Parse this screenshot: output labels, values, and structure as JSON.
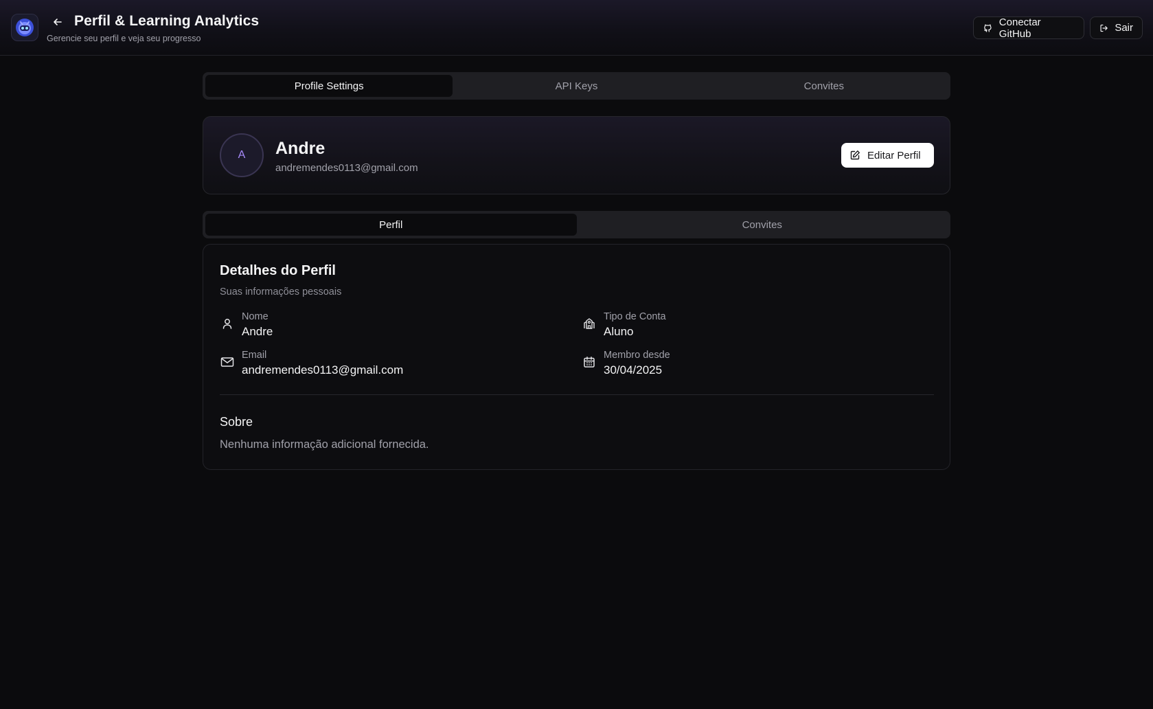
{
  "header": {
    "title": "Perfil & Learning Analytics",
    "subtitle": "Gerencie seu perfil e veja seu progresso",
    "github_button": "Conectar GitHub",
    "logout_button": "Sair"
  },
  "top_tabs": [
    {
      "label": "Profile Settings",
      "active": true
    },
    {
      "label": "API Keys",
      "active": false
    },
    {
      "label": "Convites",
      "active": false
    }
  ],
  "profile": {
    "avatar_initial": "A",
    "name": "Andre",
    "email": "andremendes0113@gmail.com",
    "edit_button": "Editar Perfil"
  },
  "sub_tabs": [
    {
      "label": "Perfil",
      "active": true
    },
    {
      "label": "Convites",
      "active": false
    }
  ],
  "details": {
    "title": "Detalhes do Perfil",
    "description": "Suas informações pessoais",
    "fields": {
      "name": {
        "label": "Nome",
        "value": "Andre",
        "icon": "user-icon"
      },
      "account_type": {
        "label": "Tipo de Conta",
        "value": "Aluno",
        "icon": "school-icon"
      },
      "email": {
        "label": "Email",
        "value": "andremendes0113@gmail.com",
        "icon": "mail-icon"
      },
      "member_since": {
        "label": "Membro desde",
        "value": "30/04/2025",
        "icon": "calendar-icon"
      }
    },
    "about_title": "Sobre",
    "about_text": "Nenhuma informação adicional fornecida."
  },
  "colors": {
    "background": "#0b0b0d",
    "accent": "#a78bfa",
    "button_primary_bg": "#ffffff"
  }
}
